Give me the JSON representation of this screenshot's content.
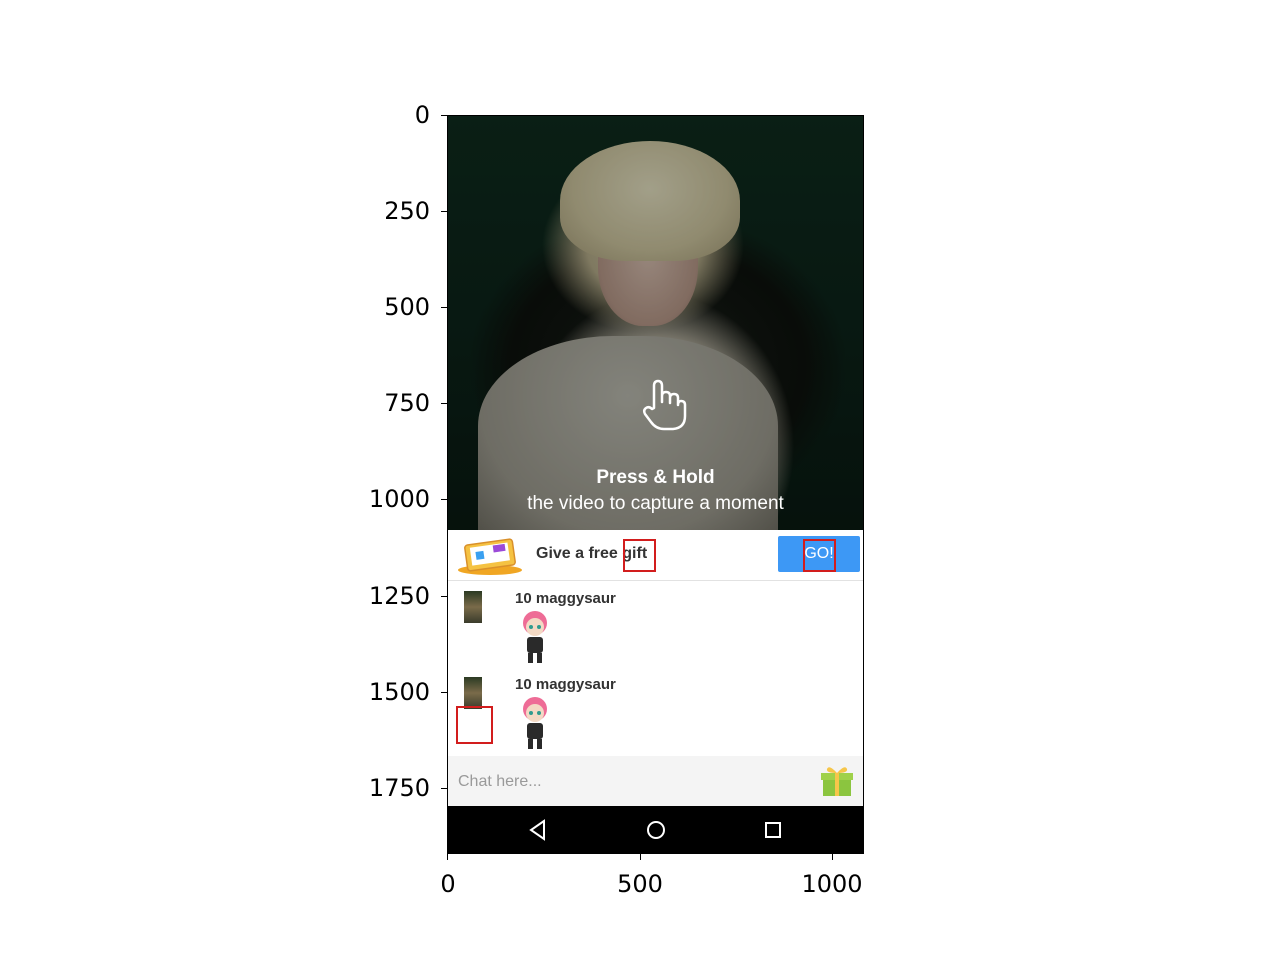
{
  "axes": {
    "y_ticks": [
      "0",
      "250",
      "500",
      "750",
      "1000",
      "1250",
      "1500",
      "1750"
    ],
    "x_ticks": [
      "0",
      "500",
      "1000"
    ]
  },
  "screen": {
    "overlay": {
      "title": "Press & Hold",
      "subtitle": "the video to capture a moment"
    },
    "gift_bar": {
      "text": "Give a free gift",
      "button": "GO!"
    },
    "messages": [
      {
        "user": "10 maggysaur"
      },
      {
        "user": "10 maggysaur"
      }
    ],
    "chat": {
      "placeholder": "Chat here..."
    }
  },
  "colors": {
    "accent": "#3d98f5",
    "annotation": "#d21d1d"
  }
}
